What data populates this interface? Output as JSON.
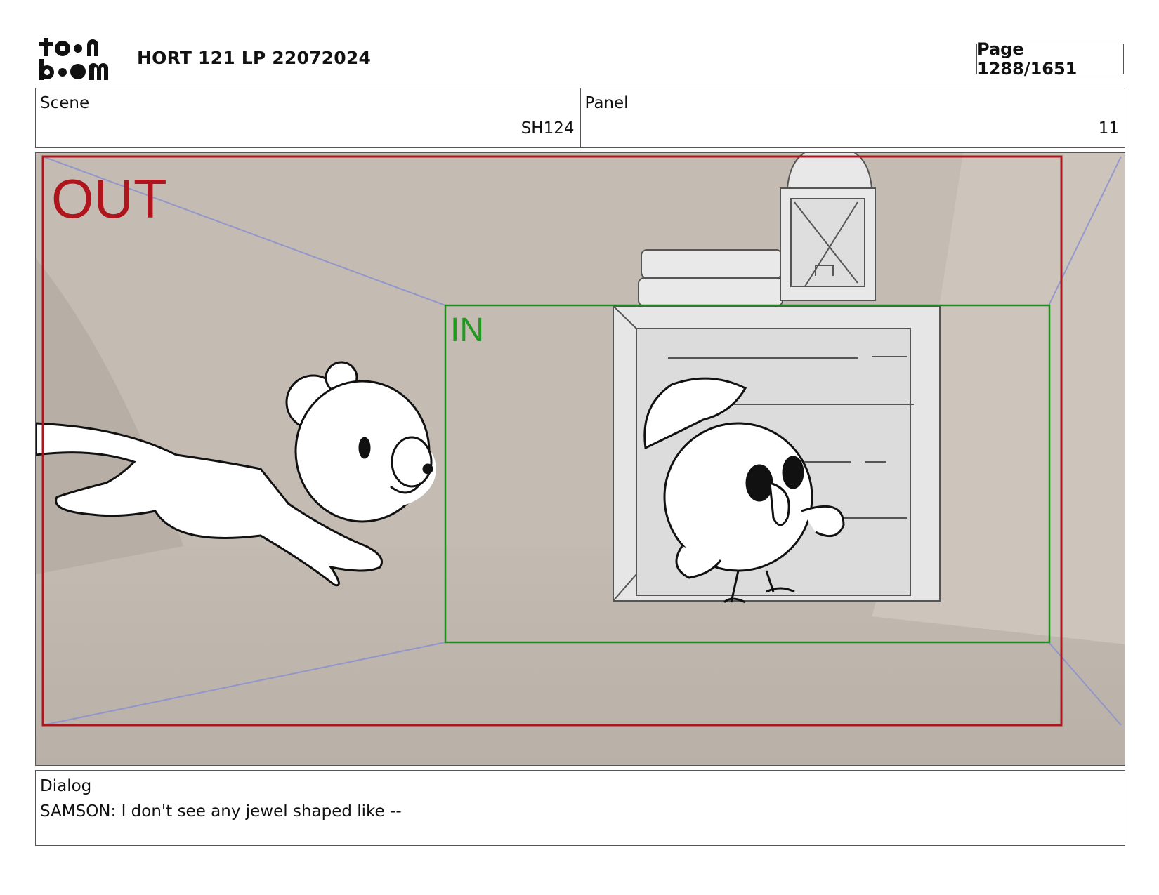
{
  "header": {
    "logo_text": "toon boom",
    "title": "HORT 121 LP 22072024",
    "page_label": "Page 1288/1651"
  },
  "scene": {
    "label": "Scene",
    "value": "SH124"
  },
  "panel": {
    "label": "Panel",
    "value": "11"
  },
  "frame_labels": {
    "out": "OUT",
    "in": "IN"
  },
  "colors": {
    "out_frame": "#b0141c",
    "in_frame": "#1f8a1f",
    "camera_guides": "#8b8fcf",
    "background": "#bfb7ae"
  },
  "dialog": {
    "label": "Dialog",
    "text": "SAMSON: I don't see any jewel shaped like --"
  }
}
